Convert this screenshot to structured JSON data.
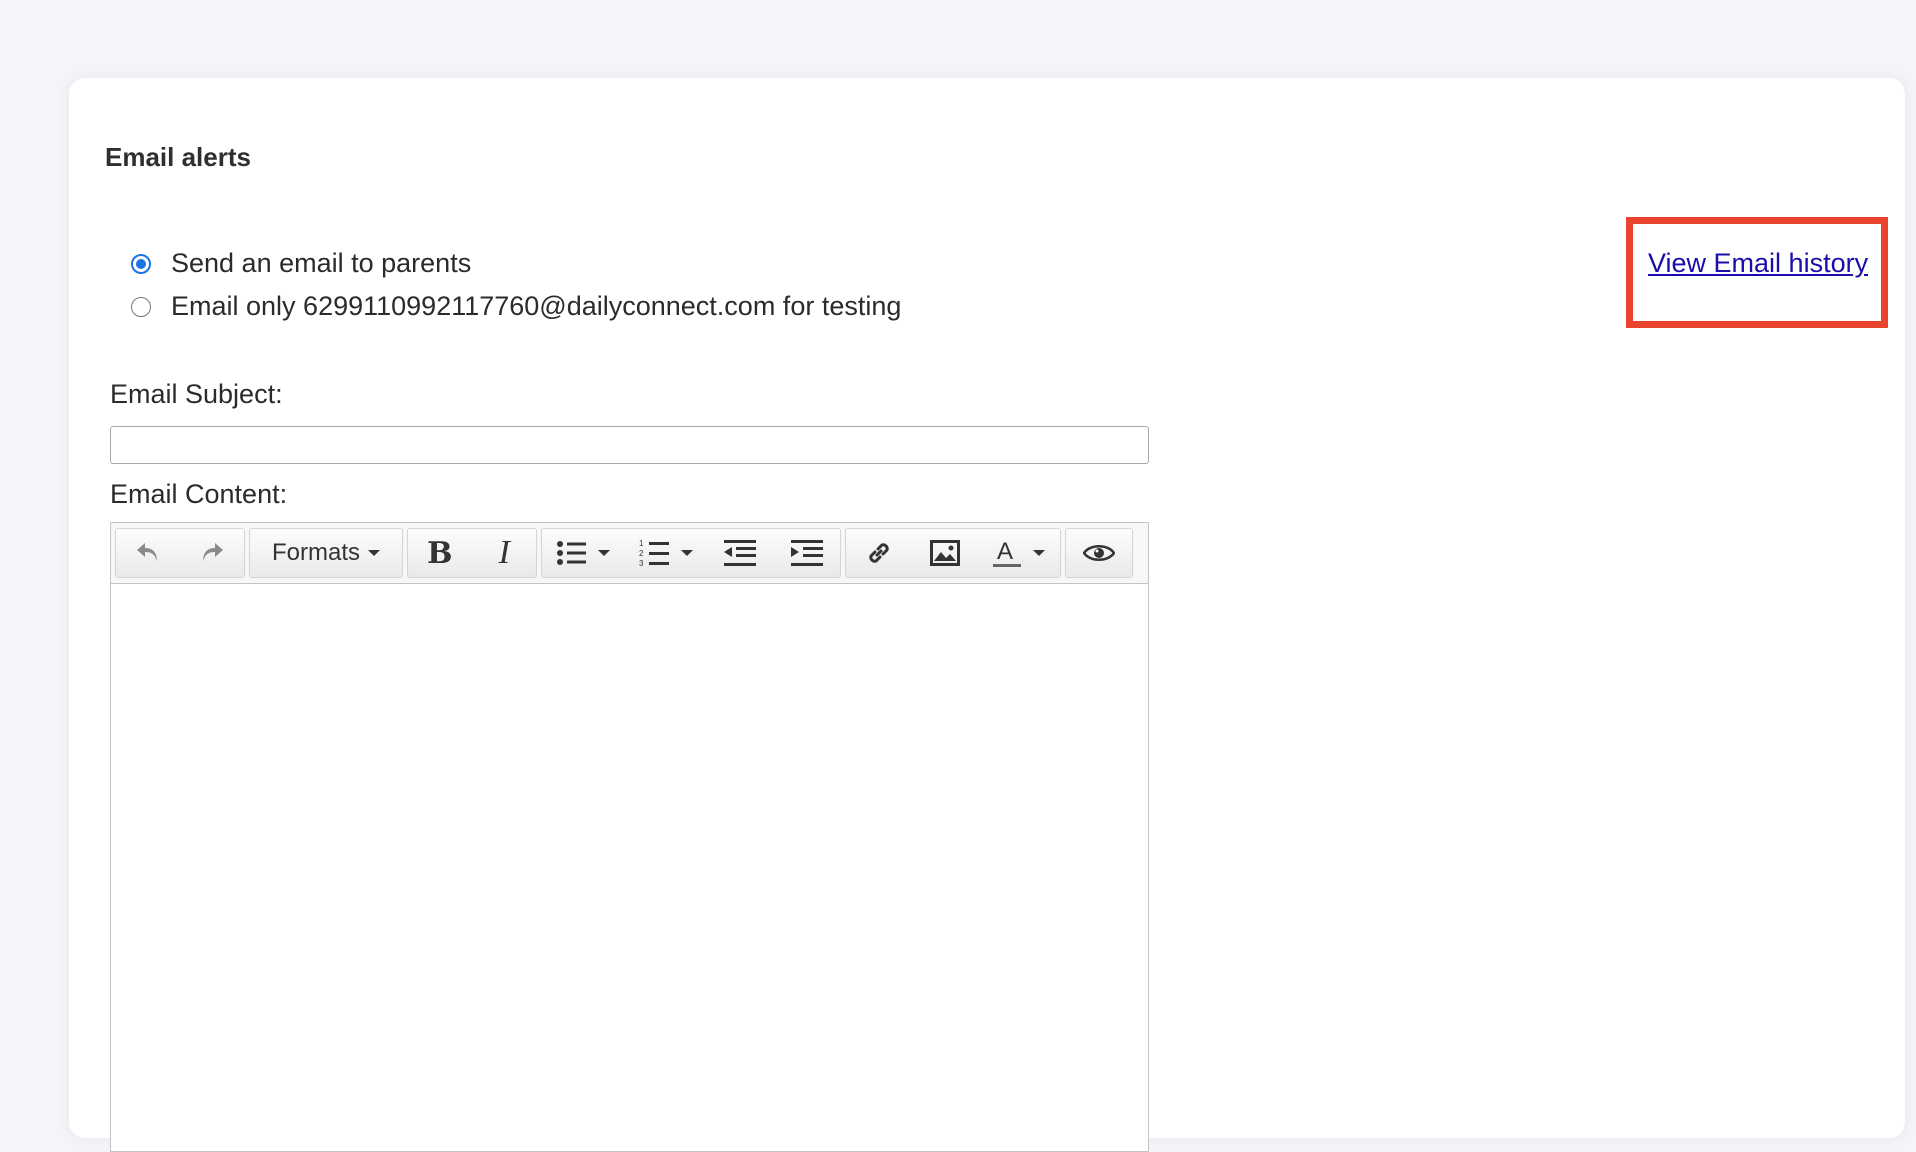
{
  "section": {
    "title": "Email alerts"
  },
  "recipients": {
    "option1_label": "Send an email to parents",
    "option2_label": "Email only 6299110992117760@dailyconnect.com for testing",
    "selected": "option1"
  },
  "history_link": {
    "label": "View Email history",
    "highlight_color": "#e8442e"
  },
  "subject": {
    "label": "Email Subject:",
    "value": "",
    "placeholder": ""
  },
  "content": {
    "label": "Email Content:",
    "value": ""
  },
  "toolbar": {
    "formats_label": "Formats",
    "icons": [
      "undo-icon",
      "redo-icon",
      "bold-icon",
      "italic-icon",
      "bullet-list-icon",
      "numbered-list-icon",
      "outdent-icon",
      "indent-icon",
      "link-icon",
      "image-icon",
      "text-color-icon",
      "preview-icon"
    ]
  },
  "colors": {
    "accent": "#1a73e8",
    "link": "#1a0dab",
    "background": "#f4f5f9"
  }
}
